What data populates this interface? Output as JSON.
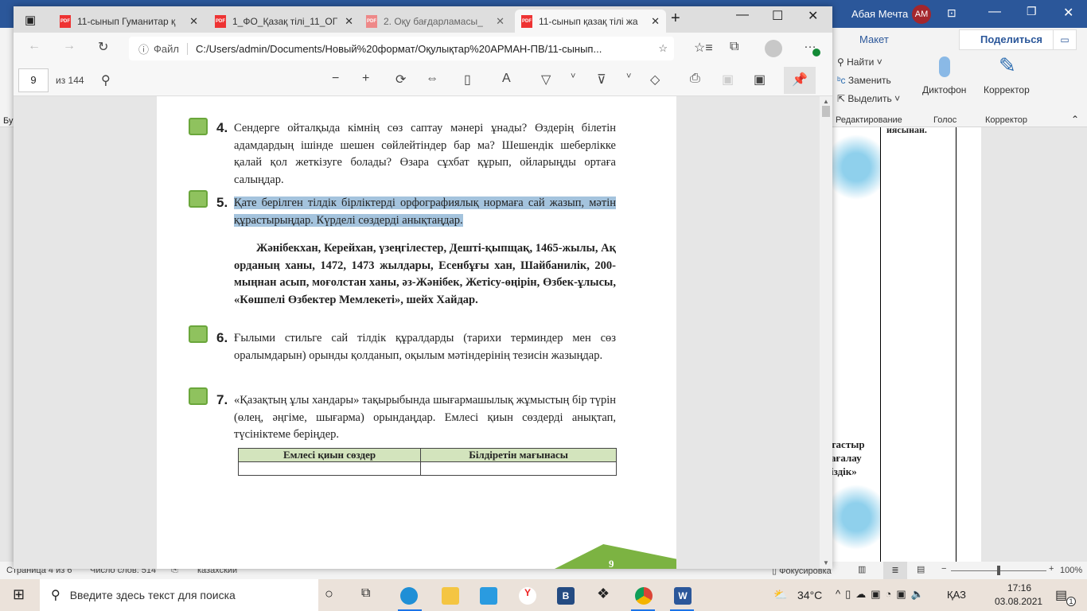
{
  "word": {
    "user": "Абая Мечта",
    "initials": "АМ",
    "tab_layout": "Макет",
    "share": "Поделиться",
    "editing": {
      "find": "Найти",
      "replace": "Заменить",
      "select": "Выделить",
      "group": "Редактирование"
    },
    "voice": {
      "dictate": "Диктофон",
      "group": "Голос"
    },
    "editor": {
      "label": "Корректор",
      "group": "Корректор"
    },
    "left_fragment": "Бу",
    "doc": {
      "cell_text": "иясынан.",
      "side_lines": [
        "тастыр",
        "ағалау",
        "іздік»"
      ]
    },
    "status": {
      "page": "Страница 4 из 6",
      "words": "Число слов: 514",
      "lang": "казахский",
      "focus": "Фокусировка",
      "zoom": "100%",
      "zoom_pct": 100
    }
  },
  "edge": {
    "tabs": [
      {
        "title": "11-сынып Гуманитар қ"
      },
      {
        "title": "1_ФО_Қазақ тілі_11_ОГ"
      },
      {
        "title": "2. Оқу бағдарламасы_"
      },
      {
        "title": "11-сынып қазақ тілі жа"
      }
    ],
    "address": {
      "scheme": "Файл",
      "url": "C:/Users/admin/Documents/Новый%20формат/Оқулықтар%20АРМАН-ПВ/11-сынып..."
    },
    "pdf": {
      "page": "9",
      "of": "из 144"
    }
  },
  "pdf_page": {
    "tasks": [
      {
        "num": "4.",
        "text": "Сендерге ойталқыда кімнің сөз саптау мәнері ұнады? Өздерің білетін адамдардың ішінде шешен сөйлейтіндер бар ма? Шешендік шеберлікке қалай қол жеткізуге болады? Өзара сұхбат құрып, ойларыңды ортаға салыңдар."
      },
      {
        "num": "5.",
        "text": "Қате берілген тілдік бірліктерді орфографиялық нормаға сай жазып, мәтін құрастырыңдар. Күрделі сөздерді анықтаңдар."
      },
      {
        "num": "6.",
        "text": "Ғылыми стильге сай тілдік құралдарды (тарихи терминдер мен сөз оралымдарын) орынды қолданып, оқылым мәтіндерінің тезисін жазыңдар."
      },
      {
        "num": "7.",
        "text": "«Қазақтың ұлы хандары» тақырыбында шығармашылық жұмыстың бір түрін (өлең, әңгіме, шығарма) орындаңдар. Емлесі қиын сөздерді анықтап, түсініктеме беріңдер."
      }
    ],
    "passage": "Жәнібекхан, Керейхан, үзеңгілестер, Дешті-қыпщақ, 1465-жылы, Ақ орданың ханы, 1472, 1473 жылдары, Есенбұғы хан, Шайбанилік, 200-мыңнан асып, моғолстан ханы, әз-Жәнібек, Жетісу-өңірін, Өзбек-ұлысы, «Көшпелі Өзбектер Мемлекеті», шейх Хайдар.",
    "table_headers": [
      "Емлесі қиын сөздер",
      "Білдіретін мағынасы"
    ],
    "page_number": "9"
  },
  "taskbar": {
    "search": "Введите здесь текст для поиска",
    "weather": "34°C",
    "lang": "ҚАЗ",
    "time": "17:16",
    "date": "03.08.2021",
    "notif": "1"
  }
}
